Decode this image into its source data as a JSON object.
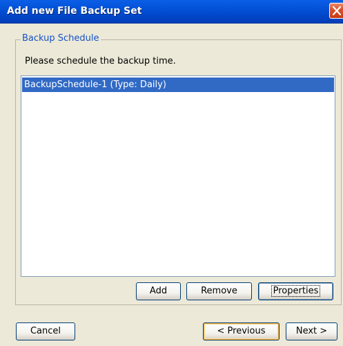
{
  "window": {
    "title": "Add new File Backup Set"
  },
  "icons": {
    "close": "close-icon"
  },
  "schedule_group": {
    "legend": "Backup Schedule",
    "instruction": "Please schedule the backup time.",
    "items": [
      {
        "label": "BackupSchedule-1 (Type: Daily)",
        "selected": true
      }
    ],
    "buttons": {
      "add": "Add",
      "remove": "Remove",
      "properties": "Properties"
    }
  },
  "footer": {
    "cancel": "Cancel",
    "previous": "< Previous",
    "next": "Next >"
  },
  "colors": {
    "title_bar": "#0453D9",
    "legend_text": "#1652C8",
    "selection": "#316AC5",
    "focus_ring": "#F8B33C"
  }
}
